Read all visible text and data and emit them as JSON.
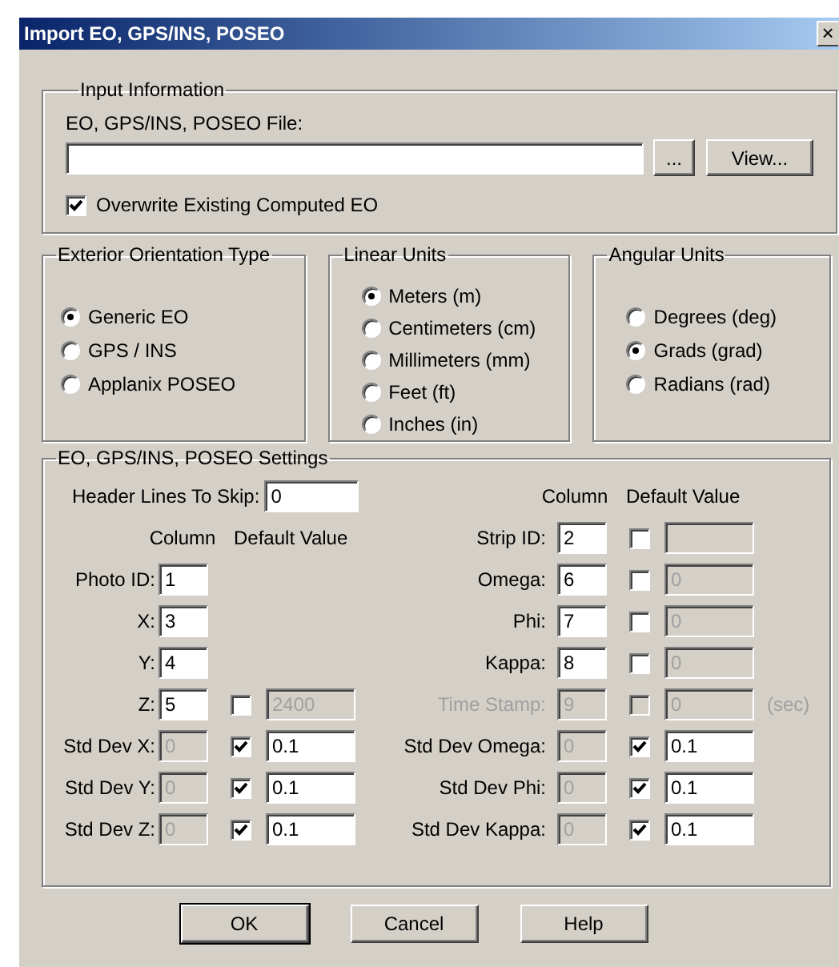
{
  "window": {
    "title": "Import EO, GPS/INS, POSEO",
    "close": "×"
  },
  "input_information": {
    "title": "Input Information",
    "file_label": "EO, GPS/INS, POSEO File:",
    "browse_button": "...",
    "view_button": "View...",
    "overwrite": {
      "label": "Overwrite Existing Computed EO",
      "checked": true
    }
  },
  "exterior_orientation_type": {
    "title": "Exterior Orientation Type",
    "options": [
      {
        "label": "Generic EO",
        "selected": true
      },
      {
        "label": "GPS / INS",
        "selected": false
      },
      {
        "label": "Applanix POSEO",
        "selected": false
      }
    ]
  },
  "linear_units": {
    "title": "Linear Units",
    "options": [
      {
        "label": "Meters (m)",
        "selected": true
      },
      {
        "label": "Centimeters (cm)",
        "selected": false
      },
      {
        "label": "Millimeters (mm)",
        "selected": false
      },
      {
        "label": "Feet (ft)",
        "selected": false
      },
      {
        "label": "Inches (in)",
        "selected": false
      }
    ]
  },
  "angular_units": {
    "title": "Angular Units",
    "options": [
      {
        "label": "Degrees (deg)",
        "selected": false
      },
      {
        "label": "Grads (grad)",
        "selected": true
      },
      {
        "label": "Radians (rad)",
        "selected": false
      }
    ]
  },
  "settings": {
    "title": "EO, GPS/INS, POSEO Settings",
    "header_lines": {
      "label": "Header Lines To Skip:",
      "value": "0"
    },
    "left": {
      "column_heading": "Column",
      "default_heading": "Default Value",
      "rows": [
        {
          "kind": "plain",
          "label": "Photo ID:",
          "column": "1",
          "column_disabled": false
        },
        {
          "kind": "plain",
          "label": "X:",
          "column": "3",
          "column_disabled": false
        },
        {
          "kind": "plain",
          "label": "Y:",
          "column": "4",
          "column_disabled": false
        },
        {
          "kind": "default",
          "label": "Z:",
          "column": "5",
          "column_disabled": false,
          "checked": false,
          "value": "2400",
          "value_disabled": true
        },
        {
          "kind": "default",
          "label": "Std Dev X:",
          "column": "0",
          "column_disabled": true,
          "checked": true,
          "value": "0.1",
          "value_disabled": false
        },
        {
          "kind": "default",
          "label": "Std Dev Y:",
          "column": "0",
          "column_disabled": true,
          "checked": true,
          "value": "0.1",
          "value_disabled": false
        },
        {
          "kind": "default",
          "label": "Std Dev Z:",
          "column": "0",
          "column_disabled": true,
          "checked": true,
          "value": "0.1",
          "value_disabled": false
        }
      ]
    },
    "right": {
      "column_heading": "Column",
      "default_heading": "Default Value",
      "rows": [
        {
          "kind": "default",
          "label": "Strip ID:",
          "column": "2",
          "column_disabled": false,
          "checked": false,
          "value_disabled": true
        },
        {
          "kind": "default",
          "label": "Omega:",
          "column": "6",
          "column_disabled": false,
          "checked": false,
          "value": "0",
          "value_disabled": true
        },
        {
          "kind": "default",
          "label": "Phi:",
          "column": "7",
          "column_disabled": false,
          "checked": false,
          "value": "0",
          "value_disabled": true
        },
        {
          "kind": "default",
          "label": "Kappa:",
          "column": "8",
          "column_disabled": false,
          "checked": false,
          "value": "0",
          "value_disabled": true
        },
        {
          "kind": "default",
          "label": "Time Stamp:",
          "label_disabled": true,
          "column": "9",
          "column_disabled": true,
          "checked": false,
          "checkbox_disabled": true,
          "value": "0",
          "value_disabled": true,
          "unit": "(sec)"
        },
        {
          "kind": "default",
          "label": "Std Dev Omega:",
          "column": "0",
          "column_disabled": true,
          "checked": true,
          "value": "0.1",
          "value_disabled": false
        },
        {
          "kind": "default",
          "label": "Std Dev Phi:",
          "column": "0",
          "column_disabled": true,
          "checked": true,
          "value": "0.1",
          "value_disabled": false
        },
        {
          "kind": "default",
          "label": "Std Dev Kappa:",
          "column": "0",
          "column_disabled": true,
          "checked": true,
          "value": "0.1",
          "value_disabled": false
        }
      ]
    }
  },
  "buttons": [
    {
      "label": "OK",
      "default": true
    },
    {
      "label": "Cancel",
      "default": false
    },
    {
      "label": "Help",
      "default": false
    }
  ]
}
